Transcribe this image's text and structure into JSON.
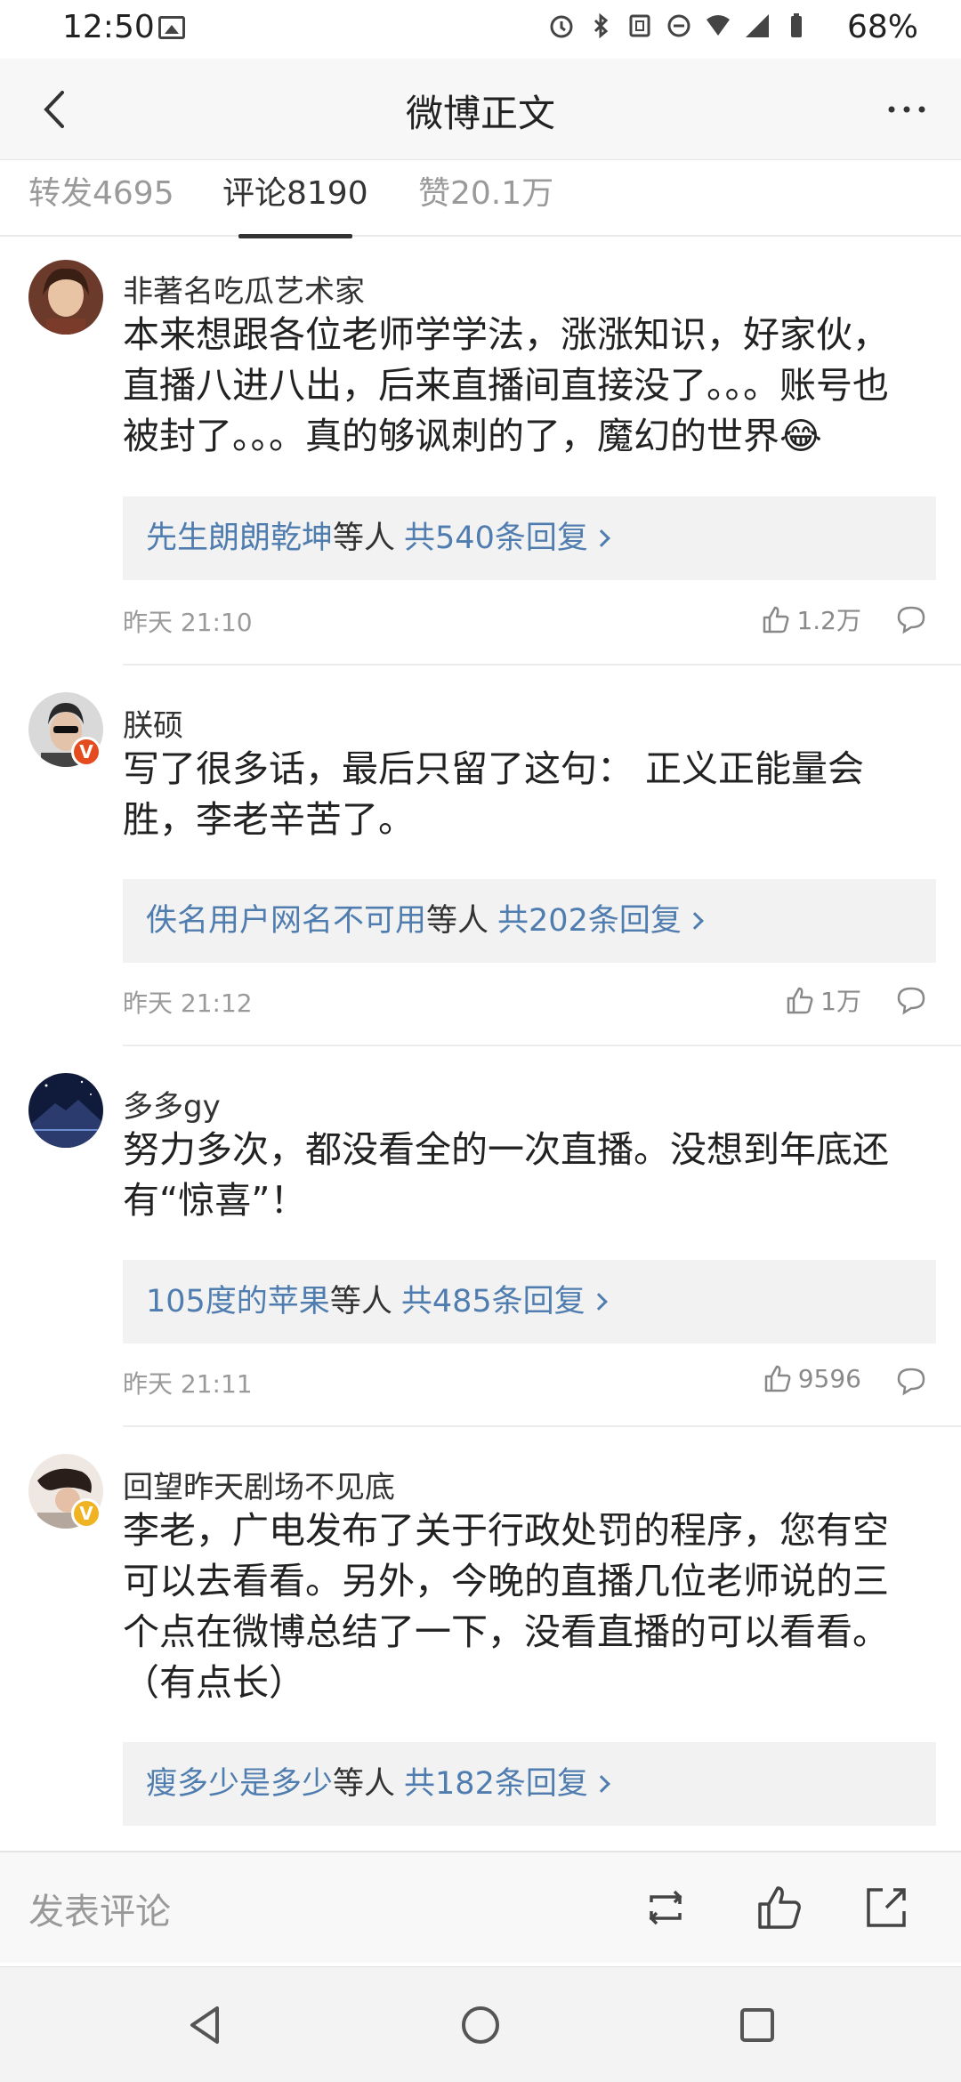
{
  "status_bar": {
    "time": "12:50",
    "battery": "68%"
  },
  "nav": {
    "title": "微博正文"
  },
  "tabs": [
    {
      "label": "转发4695",
      "active": false
    },
    {
      "label": "评论8190",
      "active": true
    },
    {
      "label": "赞20.1万",
      "active": false
    }
  ],
  "comments": [
    {
      "username": "非著名吃瓜艺术家",
      "verified": "",
      "body": "本来想跟各位老师学学法，涨涨知识，好家伙，直播八进八出，后来直播间直接没了。。。账号也被封了。。。真的够讽刺的了，魔幻的世界😂",
      "reply_user": "先生朗朗乾坤",
      "reply_mid": "等人",
      "reply_count": "共540条回复",
      "time": "昨天 21:10",
      "likes": "1.2万"
    },
    {
      "username": "朕硕",
      "verified": "red",
      "body": "写了很多话，最后只留了这句： 正义正能量会胜，李老辛苦了。",
      "reply_user": "佚名用户网名不可用",
      "reply_mid": "等人",
      "reply_count": "共202条回复",
      "time": "昨天 21:12",
      "likes": "1万"
    },
    {
      "username": "多多gy",
      "verified": "",
      "body": "努力多次，都没看全的一次直播。没想到年底还有“惊喜”！",
      "reply_user": "105度的苹果",
      "reply_mid": "等人",
      "reply_count": "共485条回复",
      "time": "昨天 21:11",
      "likes": "9596"
    },
    {
      "username": "回望昨天剧场不见底",
      "verified": "gold",
      "body": "李老，广电发布了关于行政处罚的程序，您有空可以去看看。另外，今晚的直播几位老师说的三个点在微博总结了一下，没看直播的可以看看。（有点长）",
      "reply_user": "瘦多少是多少",
      "reply_mid": "等人",
      "reply_count": "共182条回复",
      "time": "",
      "likes": ""
    }
  ],
  "bottom_bar": {
    "compose_placeholder": "发表评论"
  },
  "icons": {
    "back": "chevron-left-icon",
    "more": "more-dots-icon",
    "like": "thumbs-up-icon",
    "comment": "comment-bubble-icon",
    "repost": "repost-icon",
    "share": "share-icon"
  },
  "colors": {
    "link": "#507daf",
    "verified_red": "#e44b1e",
    "verified_gold": "#f0b321"
  }
}
